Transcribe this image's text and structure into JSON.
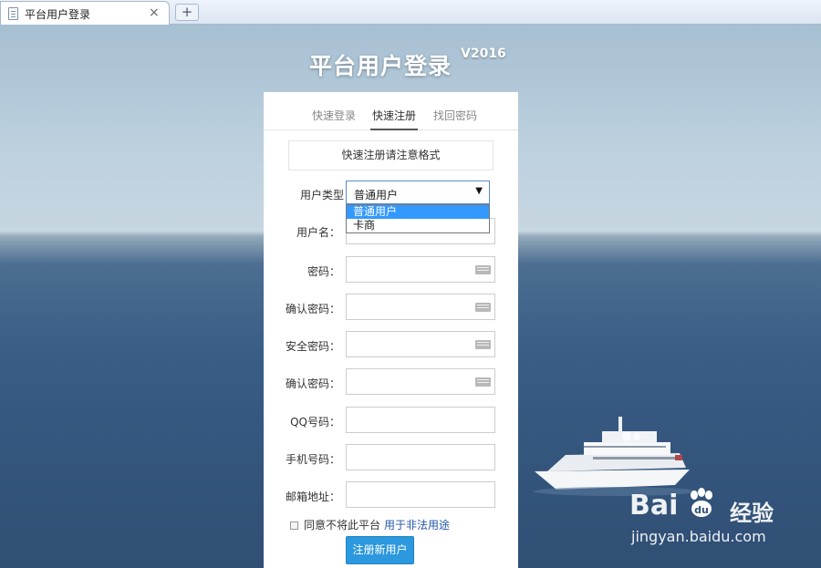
{
  "browser": {
    "tab_title": "平台用户登录",
    "close_glyph": "×",
    "new_tab_glyph": "+"
  },
  "page": {
    "title": "平台用户登录",
    "version": "V2016"
  },
  "form_tabs": [
    {
      "label": "快速登录",
      "active": false
    },
    {
      "label": "快速注册",
      "active": true
    },
    {
      "label": "找回密码",
      "active": false
    }
  ],
  "notice": "快速注册请注意格式",
  "user_type": {
    "label": "用户类型",
    "selected": "普通用户",
    "arrow": "▼",
    "options": [
      "普通用户",
      "卡商"
    ]
  },
  "fields": [
    {
      "label": "用户名：",
      "keyboard": false
    },
    {
      "label": "密码：",
      "keyboard": true
    },
    {
      "label": "确认密码：",
      "keyboard": true
    },
    {
      "label": "安全密码：",
      "keyboard": true
    },
    {
      "label": "确认密码：",
      "keyboard": true
    },
    {
      "label": "QQ号码：",
      "keyboard": false
    },
    {
      "label": "手机号码：",
      "keyboard": false
    },
    {
      "label": "邮箱地址：",
      "keyboard": false
    }
  ],
  "agreement": {
    "text": "同意不将此平台",
    "link": "用于非法用途"
  },
  "submit_label": "注册新用户",
  "watermark": {
    "brand_left": "Bai",
    "brand_right": "du",
    "brand_cn": "经验",
    "url": "jingyan.baidu.com"
  }
}
